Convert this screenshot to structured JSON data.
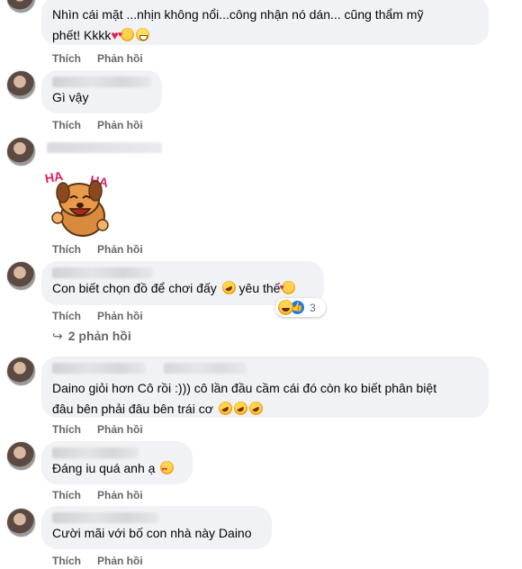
{
  "actions": {
    "like": "Thích",
    "reply": "Phản hồi"
  },
  "comments": [
    {
      "text": "Nhìn cái mặt ...nhịn không nổi...công nhận nó dán... cũng thẩm mỹ",
      "text2": "phết! Kkkk",
      "emojis": [
        "heart",
        "smiling-face-with-hearts",
        "grinning-face"
      ]
    },
    {
      "text": "Gì vậy"
    },
    {
      "sticker": {
        "label_left": "HA",
        "label_right": "HA",
        "icon": "laughing-dog-sticker"
      }
    },
    {
      "text": "Con biết chọn đồ để chơi đấy",
      "text_after": " yêu thế",
      "emojis": [
        "rolling-on-floor-laughing",
        "smiling-face-with-hearts"
      ],
      "reactions": {
        "icons": [
          "haha-reaction",
          "like-reaction"
        ],
        "count": "3"
      },
      "replies_label": "2 phản hồi"
    },
    {
      "text": "Daino giỏi hơn Cô rồi :))) cô lần đầu cầm cái đó còn ko biết phân biệt",
      "text2": "đâu bên phải đâu bên trái cơ",
      "emojis": [
        "rolling-on-floor-laughing",
        "rolling-on-floor-laughing",
        "rolling-on-floor-laughing"
      ]
    },
    {
      "text": "Đáng iu quá anh ạ",
      "emojis": [
        "smiling-face-with-heart-eyes"
      ]
    },
    {
      "text": "Cười mãi với bố con nhà này Daino"
    }
  ],
  "colors": {
    "bubble": "#f0f2f5",
    "meta": "#65676b",
    "text": "#050505",
    "like_blue": "#1877f2"
  }
}
